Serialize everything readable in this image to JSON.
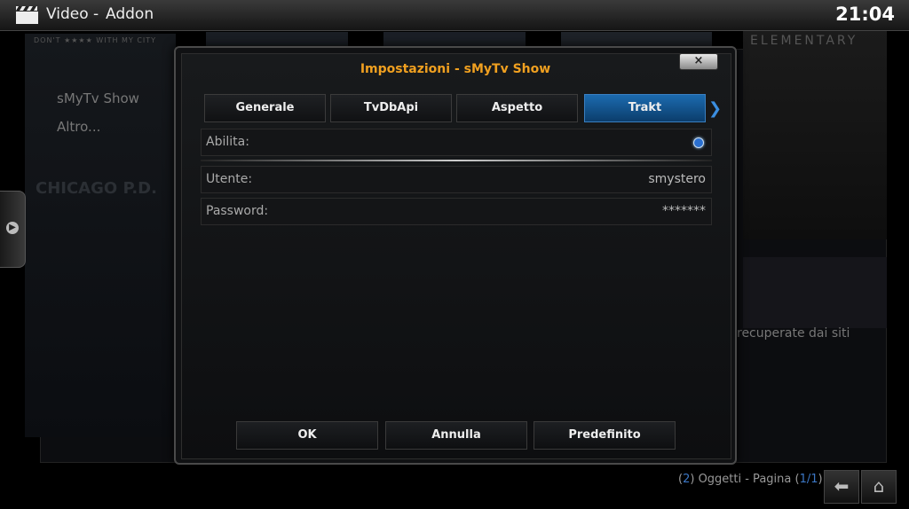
{
  "header": {
    "section": "Video",
    "separator": "-",
    "subsection": "Addon",
    "clock": "21:04",
    "icon": "clapperboard-icon"
  },
  "background": {
    "poster1_tag": "DON'T ★★★★ WITH MY CITY",
    "poster1_title": "CHICAGO P.D.",
    "poster5_title": "ELEMENTARY",
    "list_items": [
      "sMyTv Show",
      "Altro..."
    ],
    "description_fragment": "recuperate dai siti"
  },
  "dialog": {
    "title": "Impostazioni - sMyTv Show",
    "close_label": "×",
    "tabs": [
      {
        "label": "Generale",
        "active": false
      },
      {
        "label": "TvDbApi",
        "active": false
      },
      {
        "label": "Aspetto",
        "active": false
      },
      {
        "label": "Trakt",
        "active": true
      }
    ],
    "settings": {
      "enable_label": "Abilita:",
      "user_label": "Utente:",
      "user_value": "smystero",
      "password_label": "Password:",
      "password_value": "*******"
    },
    "buttons": {
      "ok": "OK",
      "cancel": "Annulla",
      "default": "Predefinito"
    }
  },
  "footer": {
    "count_open": "(",
    "count": "2",
    "count_text": ") Oggetti - Pagina (",
    "page": "1/1",
    "close_paren": ")"
  },
  "colors": {
    "accent": "#f0a020",
    "tab_active": "#1c6bb0",
    "highlight": "#3b76c4"
  }
}
